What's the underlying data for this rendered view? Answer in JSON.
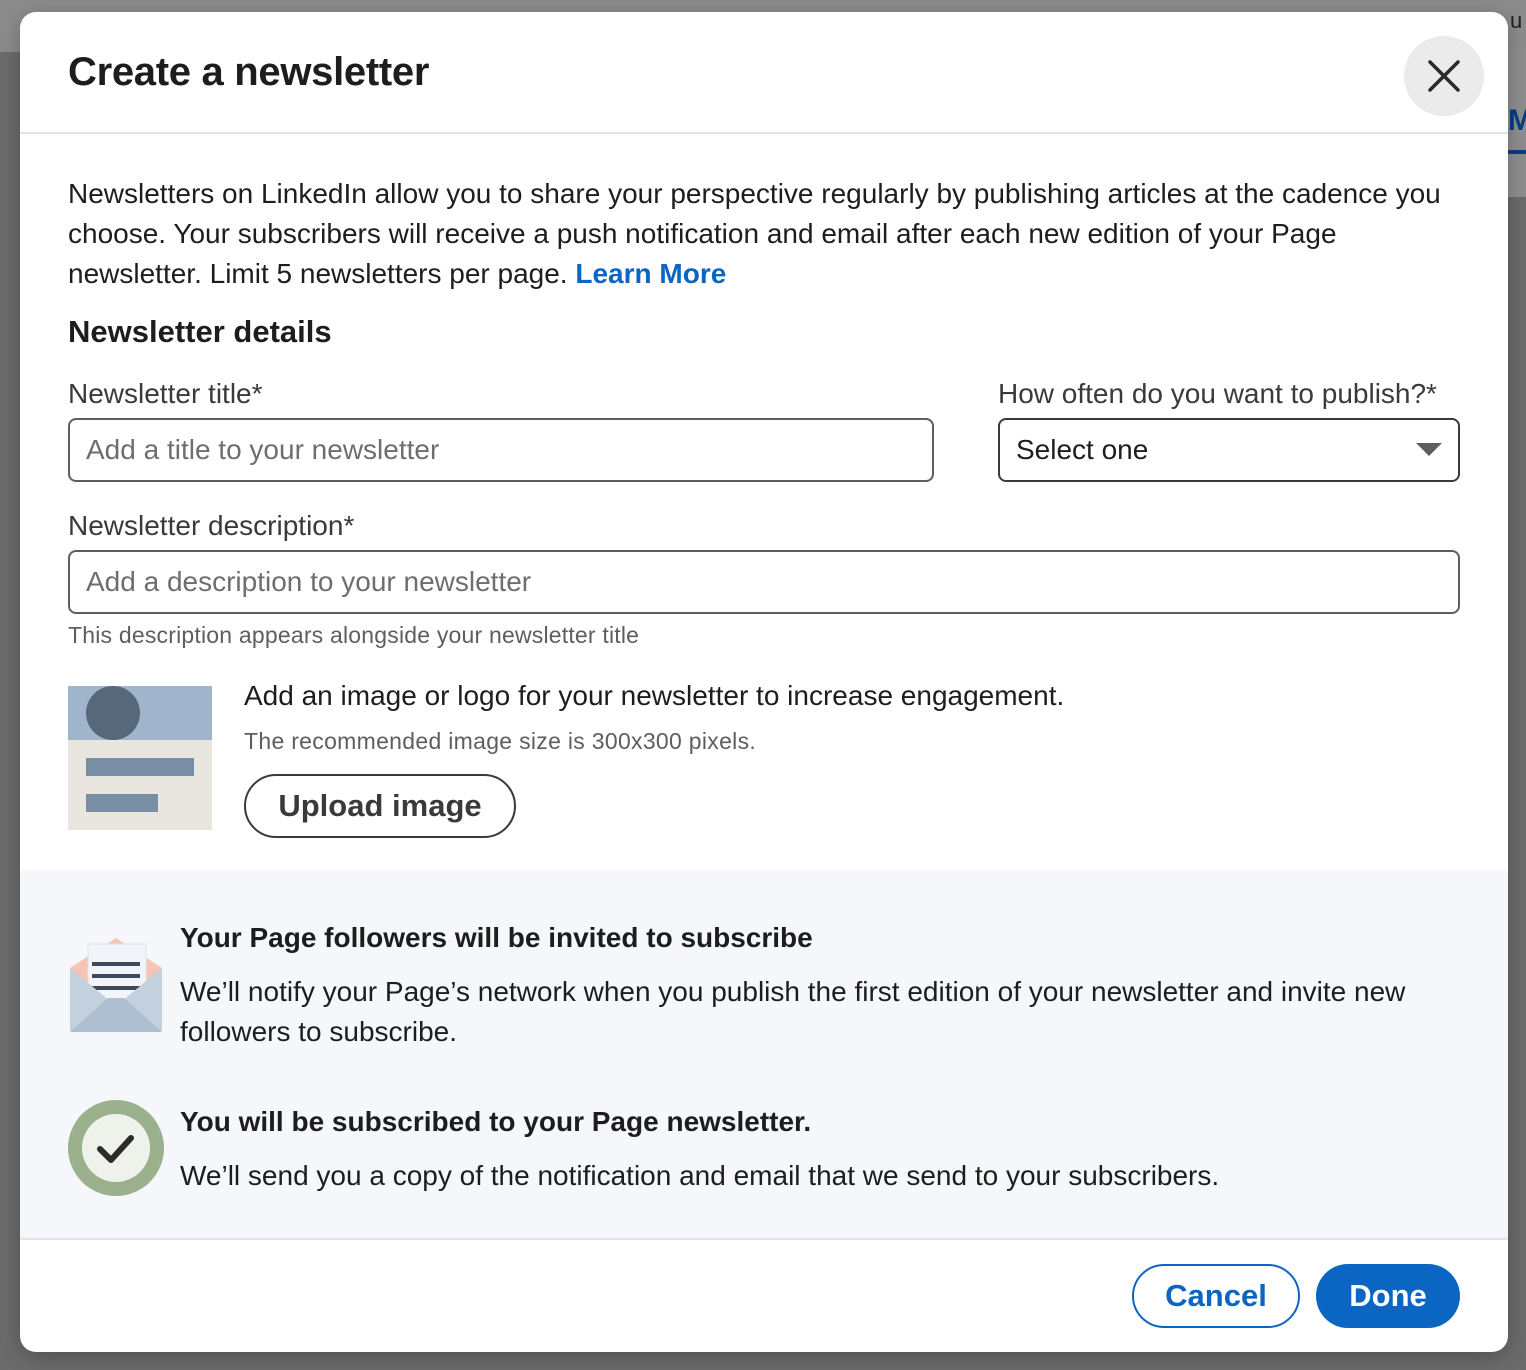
{
  "dialog": {
    "title": "Create a newsletter",
    "intro_text": "Newsletters on LinkedIn allow you to share your perspective regularly by publishing articles at the cadence you choose. Your subscribers will receive a push notification and email after each new edition of your Page newsletter. Limit 5 newsletters per page.",
    "learn_more_label": "Learn More"
  },
  "details": {
    "heading": "Newsletter details",
    "title_label": "Newsletter title*",
    "title_placeholder": "Add a title to your newsletter",
    "title_value": "",
    "frequency_label": "How often do you want to publish?*",
    "frequency_selected": "Select one",
    "description_label": "Newsletter description*",
    "description_placeholder": "Add a description to your newsletter",
    "description_value": "",
    "description_helper": "This description appears alongside your newsletter title"
  },
  "upload": {
    "heading": "Add an image or logo for your newsletter to increase engagement.",
    "subtext": "The recommended image size is 300x300 pixels.",
    "button_label": "Upload image"
  },
  "info": {
    "invite_title": "Your Page followers will be invited to subscribe",
    "invite_body": "We’ll notify your Page’s network when you publish the first edition of your newsletter and invite new followers to subscribe.",
    "subscribed_title": "You will be subscribed to your Page newsletter.",
    "subscribed_body": "We’ll send you a copy of the notification and email that we send to your subscribers."
  },
  "footer": {
    "cancel_label": "Cancel",
    "done_label": "Done"
  },
  "background": {
    "partial_letter_right": "M",
    "partial_text_top_right": "u"
  },
  "icons": {
    "close": "close-icon",
    "dropdown": "caret-down-icon",
    "image_placeholder": "image-placeholder-icon",
    "envelope": "envelope-icon",
    "check": "check-circle-icon"
  },
  "colors": {
    "accent": "#0a66c2",
    "panel_bg": "#f5f7fb",
    "check_ring": "#9bb08c"
  }
}
